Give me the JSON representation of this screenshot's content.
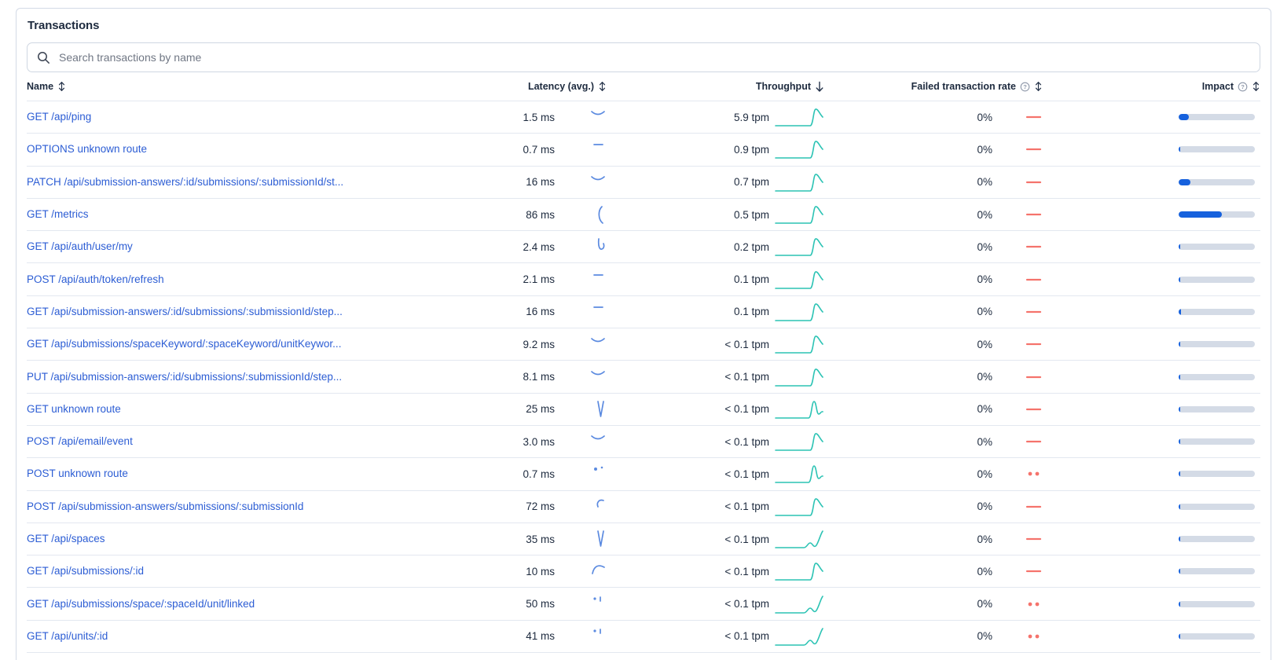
{
  "panel": {
    "title": "Transactions"
  },
  "search": {
    "placeholder": "Search transactions by name"
  },
  "colors": {
    "link": "#2c5dd4",
    "teal": "#2cc3b4",
    "salmon": "#f5736c",
    "latspark": "#5b8ae0",
    "impactfill": "#1661dd",
    "impacttrack": "#d4dbe6",
    "text": "#1d2a3e",
    "placeholder": "#707784",
    "border": "#d3dae6",
    "rowborder": "#e3e8f0",
    "icongray": "#8e98a9"
  },
  "table": {
    "columns": [
      {
        "label": "Name",
        "sort": "sortable",
        "info": false
      },
      {
        "label": "Latency (avg.)",
        "sort": "sortable",
        "info": false
      },
      {
        "label": "Throughput",
        "sort": "desc",
        "info": false
      },
      {
        "label": "Failed transaction rate",
        "sort": "sortable",
        "info": true
      },
      {
        "label": "Impact",
        "sort": "sortable",
        "info": true
      }
    ],
    "rows": [
      {
        "name": "GET /api/ping",
        "latency": "1.5 ms",
        "latency_spark": "dip",
        "throughput": "5.9 tpm",
        "throughput_spark": "peak",
        "failed_rate": "0%",
        "failed_spark": "dash",
        "impact_pct": 13
      },
      {
        "name": "OPTIONS unknown route",
        "latency": "0.7 ms",
        "latency_spark": "dash",
        "throughput": "0.9 tpm",
        "throughput_spark": "peak",
        "failed_rate": "0%",
        "failed_spark": "dash",
        "impact_pct": 2
      },
      {
        "name": "PATCH /api/submission-answers/:id/submissions/:submissionId/st...",
        "latency": "16 ms",
        "latency_spark": "dip",
        "throughput": "0.7 tpm",
        "throughput_spark": "peak",
        "failed_rate": "0%",
        "failed_spark": "dash",
        "impact_pct": 15
      },
      {
        "name": "GET /metrics",
        "latency": "86 ms",
        "latency_spark": "rise",
        "throughput": "0.5 tpm",
        "throughput_spark": "peak",
        "failed_rate": "0%",
        "failed_spark": "dash",
        "impact_pct": 57
      },
      {
        "name": "GET /api/auth/user/my",
        "latency": "2.4 ms",
        "latency_spark": "check",
        "throughput": "0.2 tpm",
        "throughput_spark": "peak",
        "failed_rate": "0%",
        "failed_spark": "dash",
        "impact_pct": 2
      },
      {
        "name": "POST /api/auth/token/refresh",
        "latency": "2.1 ms",
        "latency_spark": "dash",
        "throughput": "0.1 tpm",
        "throughput_spark": "peak",
        "failed_rate": "0%",
        "failed_spark": "dash",
        "impact_pct": 1
      },
      {
        "name": "GET /api/submission-answers/:id/submissions/:submissionId/step...",
        "latency": "16 ms",
        "latency_spark": "dash",
        "throughput": "0.1 tpm",
        "throughput_spark": "peak",
        "failed_rate": "0%",
        "failed_spark": "dash",
        "impact_pct": 3
      },
      {
        "name": "GET /api/submissions/spaceKeyword/:spaceKeyword/unitKeywor...",
        "latency": "9.2 ms",
        "latency_spark": "dip",
        "throughput": "< 0.1 tpm",
        "throughput_spark": "peak",
        "failed_rate": "0%",
        "failed_spark": "dash",
        "impact_pct": 1.5
      },
      {
        "name": "PUT /api/submission-answers/:id/submissions/:submissionId/step...",
        "latency": "8.1 ms",
        "latency_spark": "dip",
        "throughput": "< 0.1 tpm",
        "throughput_spark": "peak",
        "failed_rate": "0%",
        "failed_spark": "dash",
        "impact_pct": 1.5
      },
      {
        "name": "GET unknown route",
        "latency": "25 ms",
        "latency_spark": "vee",
        "throughput": "< 0.1 tpm",
        "throughput_spark": "peak-dip",
        "failed_rate": "0%",
        "failed_spark": "dash",
        "impact_pct": 1.5
      },
      {
        "name": "POST /api/email/event",
        "latency": "3.0 ms",
        "latency_spark": "dip",
        "throughput": "< 0.1 tpm",
        "throughput_spark": "peak",
        "failed_rate": "0%",
        "failed_spark": "dash",
        "impact_pct": 1
      },
      {
        "name": "POST unknown route",
        "latency": "0.7 ms",
        "latency_spark": "dots",
        "throughput": "< 0.1 tpm",
        "throughput_spark": "peak-dip",
        "failed_rate": "0%",
        "failed_spark": "dots",
        "impact_pct": 1
      },
      {
        "name": "POST /api/submission-answers/submissions/:submissionId",
        "latency": "72 ms",
        "latency_spark": "arc",
        "throughput": "< 0.1 tpm",
        "throughput_spark": "peak",
        "failed_rate": "0%",
        "failed_spark": "dash",
        "impact_pct": 2
      },
      {
        "name": "GET /api/spaces",
        "latency": "35 ms",
        "latency_spark": "vee",
        "throughput": "< 0.1 tpm",
        "throughput_spark": "end-rise",
        "failed_rate": "0%",
        "failed_spark": "dash",
        "impact_pct": 1.5
      },
      {
        "name": "GET /api/submissions/:id",
        "latency": "10 ms",
        "latency_spark": "cap",
        "throughput": "< 0.1 tpm",
        "throughput_spark": "peak",
        "failed_rate": "0%",
        "failed_spark": "dash",
        "impact_pct": 1
      },
      {
        "name": "GET /api/submissions/space/:spaceId/unit/linked",
        "latency": "50 ms",
        "latency_spark": "ticks",
        "throughput": "< 0.1 tpm",
        "throughput_spark": "end-rise",
        "failed_rate": "0%",
        "failed_spark": "dots",
        "impact_pct": 1.5
      },
      {
        "name": "GET /api/units/:id",
        "latency": "41 ms",
        "latency_spark": "ticks",
        "throughput": "< 0.1 tpm",
        "throughput_spark": "end-rise",
        "failed_rate": "0%",
        "failed_spark": "dots",
        "impact_pct": 1.5
      }
    ]
  }
}
